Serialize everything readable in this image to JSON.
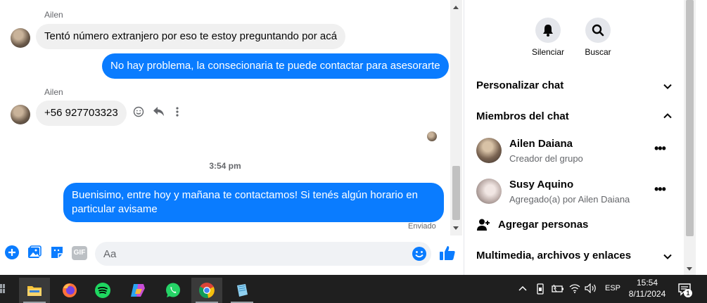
{
  "chat": {
    "messages": [
      {
        "sender": "Ailen",
        "text": "Tentó número extranjero por eso te estoy preguntando por acá"
      },
      {
        "text": "No hay problema, la consecionaria te puede contactar para asesorarte"
      },
      {
        "sender": "Ailen",
        "text": "+56 927703323"
      },
      {
        "text": "Buenisimo, entre hoy y mañana te contactamos! Si tenés algún horario en particular avisame"
      }
    ],
    "timestamp": "3:54 pm",
    "status": "Enviado"
  },
  "composer": {
    "placeholder": "Aa",
    "gif_label": "GIF"
  },
  "panel": {
    "actions": [
      {
        "label": "Silenciar",
        "icon": "bell-icon"
      },
      {
        "label": "Buscar",
        "icon": "search-icon"
      }
    ],
    "sections": {
      "customize": "Personalizar chat",
      "members": "Miembros del chat",
      "media": "Multimedia, archivos y enlaces"
    },
    "members": [
      {
        "name": "Ailen Daiana",
        "role": "Creador del grupo"
      },
      {
        "name": "Susy Aquino",
        "role": "Agregado(a) por Ailen Daiana"
      }
    ],
    "add_people": "Agregar personas"
  },
  "taskbar": {
    "apps": [
      "file-explorer-icon",
      "firefox-icon",
      "spotify-icon",
      "copilot-icon",
      "whatsapp-icon",
      "chrome-icon",
      "notepad-icon"
    ],
    "language": "ESP",
    "time": "15:54",
    "date": "8/11/2024",
    "notifications": "1"
  }
}
